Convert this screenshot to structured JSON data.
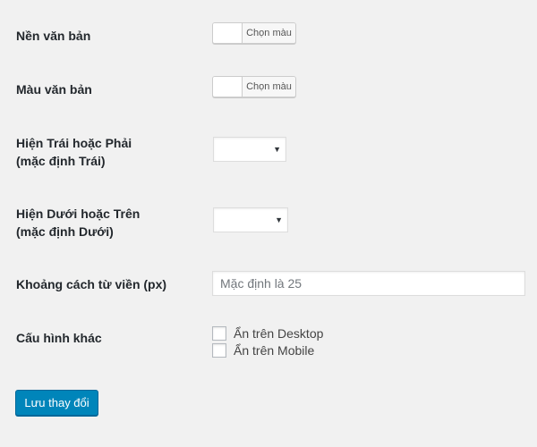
{
  "fields": {
    "bg_color": {
      "label": "Nền văn bản",
      "button_text": "Chọn màu"
    },
    "text_color": {
      "label": "Màu văn bản",
      "button_text": "Chọn màu"
    },
    "left_right": {
      "label_line1": "Hiện Trái hoặc Phải",
      "label_line2": "(mặc định Trái)",
      "selected": ""
    },
    "bottom_top": {
      "label_line1": "Hiện Dưới hoặc Trên",
      "label_line2": "(mặc định Dưới)",
      "selected": ""
    },
    "margin": {
      "label": "Khoảng cách từ viền (px)",
      "value": "",
      "placeholder": "Mặc định là 25"
    },
    "other": {
      "label": "Cấu hình khác",
      "options": [
        {
          "label": "Ẩn trên Desktop",
          "checked": false
        },
        {
          "label": "Ẩn trên Mobile",
          "checked": false
        }
      ]
    }
  },
  "save_button": "Lưu thay đổi",
  "icons": {
    "dropdown": "chevron-down-icon"
  }
}
